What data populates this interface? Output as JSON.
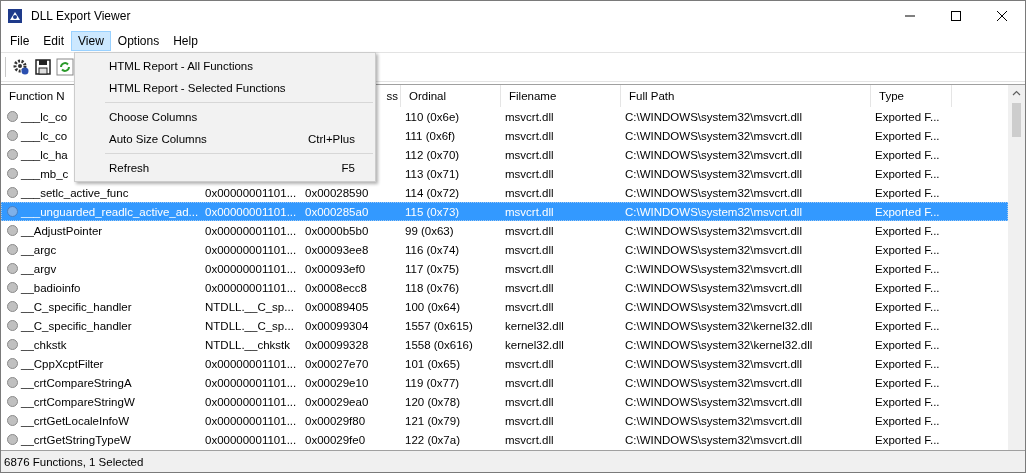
{
  "window": {
    "title": "DLL Export Viewer"
  },
  "menu_bar": [
    {
      "label": "File",
      "selected": false
    },
    {
      "label": "Edit",
      "selected": false
    },
    {
      "label": "View",
      "selected": true
    },
    {
      "label": "Options",
      "selected": false
    },
    {
      "label": "Help",
      "selected": false
    }
  ],
  "view_menu": [
    {
      "kind": "item",
      "label": "HTML Report - All Functions"
    },
    {
      "kind": "item",
      "label": "HTML Report - Selected Functions"
    },
    {
      "kind": "separator"
    },
    {
      "kind": "item",
      "label": "Choose Columns"
    },
    {
      "kind": "item",
      "label": "Auto Size Columns",
      "shortcut": "Ctrl+Plus"
    },
    {
      "kind": "separator"
    },
    {
      "kind": "item",
      "label": "Refresh",
      "shortcut": "F5"
    }
  ],
  "table": {
    "columns": [
      {
        "label": "Function N"
      },
      {},
      {
        "label": "ss"
      },
      {
        "label": "Ordinal"
      },
      {
        "label": "Filename"
      },
      {
        "label": "Full Path"
      },
      {
        "label": "Type"
      }
    ],
    "rows": [
      {
        "name": "___lc_co",
        "ordinal": "110 (0x6e)",
        "filename": "msvcrt.dll",
        "path": "C:\\WINDOWS\\system32\\msvcrt.dll",
        "type": "Exported F...",
        "selected": false
      },
      {
        "name": "___lc_co",
        "ordinal": "111 (0x6f)",
        "filename": "msvcrt.dll",
        "path": "C:\\WINDOWS\\system32\\msvcrt.dll",
        "type": "Exported F...",
        "selected": false
      },
      {
        "name": "___lc_ha",
        "ordinal": "112 (0x70)",
        "filename": "msvcrt.dll",
        "path": "C:\\WINDOWS\\system32\\msvcrt.dll",
        "type": "Exported F...",
        "selected": false
      },
      {
        "name": "___mb_c",
        "ordinal": "113 (0x71)",
        "filename": "msvcrt.dll",
        "path": "C:\\WINDOWS\\system32\\msvcrt.dll",
        "type": "Exported F...",
        "selected": false
      },
      {
        "name": "___setlc_active_func",
        "address": "0x00000001101...",
        "rva": "0x00028590",
        "ordinal": "114 (0x72)",
        "filename": "msvcrt.dll",
        "path": "C:\\WINDOWS\\system32\\msvcrt.dll",
        "type": "Exported F...",
        "selected": false
      },
      {
        "name": "___unguarded_readlc_active_ad...",
        "address": "0x00000001101...",
        "rva": "0x000285a0",
        "ordinal": "115 (0x73)",
        "filename": "msvcrt.dll",
        "path": "C:\\WINDOWS\\system32\\msvcrt.dll",
        "type": "Exported F...",
        "selected": true
      },
      {
        "name": "__AdjustPointer",
        "address": "0x00000001101...",
        "rva": "0x0000b5b0",
        "ordinal": "99 (0x63)",
        "filename": "msvcrt.dll",
        "path": "C:\\WINDOWS\\system32\\msvcrt.dll",
        "type": "Exported F...",
        "selected": false
      },
      {
        "name": "__argc",
        "address": "0x00000001101...",
        "rva": "0x00093ee8",
        "ordinal": "116 (0x74)",
        "filename": "msvcrt.dll",
        "path": "C:\\WINDOWS\\system32\\msvcrt.dll",
        "type": "Exported F...",
        "selected": false
      },
      {
        "name": "__argv",
        "address": "0x00000001101...",
        "rva": "0x00093ef0",
        "ordinal": "117 (0x75)",
        "filename": "msvcrt.dll",
        "path": "C:\\WINDOWS\\system32\\msvcrt.dll",
        "type": "Exported F...",
        "selected": false
      },
      {
        "name": "__badioinfo",
        "address": "0x00000001101...",
        "rva": "0x0008ecc8",
        "ordinal": "118 (0x76)",
        "filename": "msvcrt.dll",
        "path": "C:\\WINDOWS\\system32\\msvcrt.dll",
        "type": "Exported F...",
        "selected": false
      },
      {
        "name": "__C_specific_handler",
        "address": "NTDLL.__C_sp...",
        "rva": "0x00089405",
        "ordinal": "100 (0x64)",
        "filename": "msvcrt.dll",
        "path": "C:\\WINDOWS\\system32\\msvcrt.dll",
        "type": "Exported F...",
        "selected": false
      },
      {
        "name": "__C_specific_handler",
        "address": "NTDLL.__C_sp...",
        "rva": "0x00099304",
        "ordinal": "1557 (0x615)",
        "filename": "kernel32.dll",
        "path": "C:\\WINDOWS\\system32\\kernel32.dll",
        "type": "Exported F...",
        "selected": false
      },
      {
        "name": "__chkstk",
        "address": "NTDLL.__chkstk",
        "rva": "0x00099328",
        "ordinal": "1558 (0x616)",
        "filename": "kernel32.dll",
        "path": "C:\\WINDOWS\\system32\\kernel32.dll",
        "type": "Exported F...",
        "selected": false
      },
      {
        "name": "__CppXcptFilter",
        "address": "0x00000001101...",
        "rva": "0x00027e70",
        "ordinal": "101 (0x65)",
        "filename": "msvcrt.dll",
        "path": "C:\\WINDOWS\\system32\\msvcrt.dll",
        "type": "Exported F...",
        "selected": false
      },
      {
        "name": "__crtCompareStringA",
        "address": "0x00000001101...",
        "rva": "0x00029e10",
        "ordinal": "119 (0x77)",
        "filename": "msvcrt.dll",
        "path": "C:\\WINDOWS\\system32\\msvcrt.dll",
        "type": "Exported F...",
        "selected": false
      },
      {
        "name": "__crtCompareStringW",
        "address": "0x00000001101...",
        "rva": "0x00029ea0",
        "ordinal": "120 (0x78)",
        "filename": "msvcrt.dll",
        "path": "C:\\WINDOWS\\system32\\msvcrt.dll",
        "type": "Exported F...",
        "selected": false
      },
      {
        "name": "__crtGetLocaleInfoW",
        "address": "0x00000001101...",
        "rva": "0x00029f80",
        "ordinal": "121 (0x79)",
        "filename": "msvcrt.dll",
        "path": "C:\\WINDOWS\\system32\\msvcrt.dll",
        "type": "Exported F...",
        "selected": false
      },
      {
        "name": "__crtGetStringTypeW",
        "address": "0x00000001101...",
        "rva": "0x00029fe0",
        "ordinal": "122 (0x7a)",
        "filename": "msvcrt.dll",
        "path": "C:\\WINDOWS\\system32\\msvcrt.dll",
        "type": "Exported F...",
        "selected": false
      }
    ]
  },
  "status_bar": "6876 Functions, 1 Selected"
}
